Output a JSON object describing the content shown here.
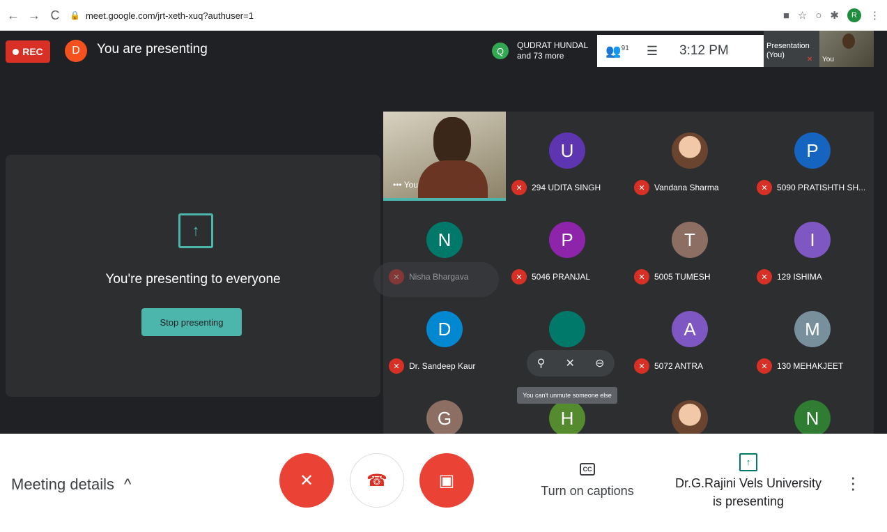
{
  "browser": {
    "url": "meet.google.com/jrt-xeth-xuq?authuser=1",
    "profile_initial": "R"
  },
  "header": {
    "rec_label": "REC",
    "self_initial": "D",
    "presenting_title": "You are presenting",
    "speaker_initial": "Q",
    "speaker_name": "QUDRAT HUNDAL",
    "speaker_more": "and 73 more",
    "people_count": "91",
    "time": "3:12 PM",
    "mini_presentation_label": "Presentation (You)",
    "mini_you_label": "You"
  },
  "presenting_card": {
    "message": "You're presenting to everyone",
    "stop_label": "Stop presenting"
  },
  "grid": {
    "you_label": "You",
    "tiles": [
      {
        "initial": "U",
        "name": "294 UDITA SINGH",
        "color": "#5e35b1"
      },
      {
        "initial": "",
        "name": "Vandana Sharma",
        "color": "#ffffff"
      },
      {
        "initial": "P",
        "name": "5090 PRATISHTH SH...",
        "color": "#1565c0"
      },
      {
        "initial": "N",
        "name": "Nisha Bhargava",
        "color": "#00796b"
      },
      {
        "initial": "P",
        "name": "5046 PRANJAL",
        "color": "#8e24aa"
      },
      {
        "initial": "T",
        "name": "5005 TUMESH",
        "color": "#8d6e63"
      },
      {
        "initial": "I",
        "name": "129 ISHIMA",
        "color": "#7e57c2"
      },
      {
        "initial": "D",
        "name": "Dr. Sandeep Kaur",
        "color": "#0288d1"
      },
      {
        "initial": "",
        "name": "",
        "color": "#00796b"
      },
      {
        "initial": "A",
        "name": "5072 ANTRA",
        "color": "#7e57c2"
      },
      {
        "initial": "M",
        "name": "130 MEHAKJEET",
        "color": "#78909c"
      },
      {
        "initial": "G",
        "name": "",
        "color": "#8d6e63"
      },
      {
        "initial": "H",
        "name": "",
        "color": "#558b2f"
      },
      {
        "initial": "",
        "name": "",
        "color": "#a1887f"
      },
      {
        "initial": "N",
        "name": "",
        "color": "#2e7d32"
      }
    ],
    "tooltip": "You can't unmute someone else"
  },
  "bottom_bar": {
    "meeting_details": "Meeting details",
    "captions_label": "Turn on captions",
    "presenter_line1": "Dr.G.Rajini Vels University",
    "presenter_line2": "is presenting"
  },
  "icons": {
    "back": "back-arrow-icon",
    "forward": "forward-arrow-icon",
    "reload": "reload-icon",
    "lock": "lock-icon",
    "people": "people-icon",
    "chat": "chat-icon",
    "mic_off": "mic-off-icon",
    "hangup": "hangup-icon",
    "camera_off": "camera-off-icon",
    "captions": "captions-icon",
    "present": "present-icon",
    "more": "more-vert-icon",
    "pin": "pin-icon",
    "remove": "remove-icon"
  },
  "colors": {
    "rec": "#d93025",
    "accent": "#4db6ac",
    "danger": "#ea4335"
  }
}
